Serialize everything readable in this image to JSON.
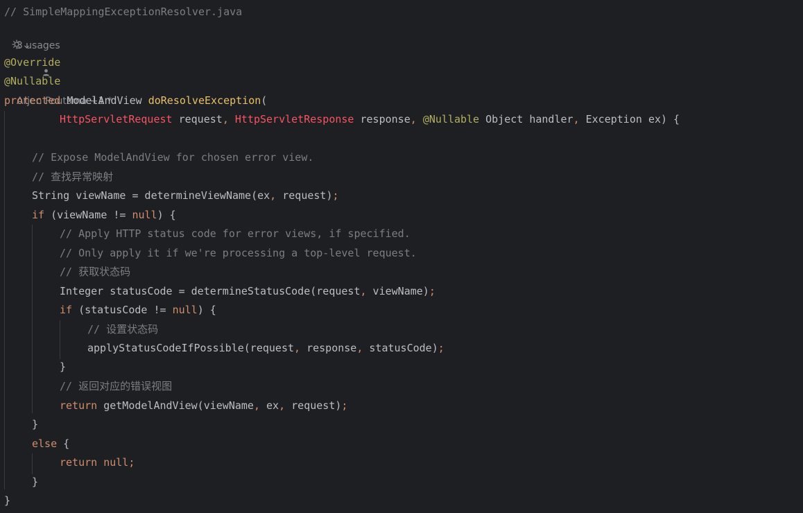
{
  "editor": {
    "file_comment": "// SimpleMappingExceptionResolver.java",
    "inlay": {
      "usages": "3 usages",
      "author": "Arjen Poutsma +1 *"
    },
    "code": {
      "ann_override": "@Override",
      "ann_nullable": "@Nullable",
      "kw_protected": "protected",
      "type_mav": "ModelAndView",
      "method_name": "doResolveException",
      "open_paren": "(",
      "p_req_type": "HttpServletRequest",
      "p_req_name": "request",
      "comma": ",",
      "p_resp_type": "HttpServletResponse",
      "p_resp_name": "response",
      "p_handler_ann": "@Nullable",
      "p_handler_type": "Object",
      "p_handler_name": "handler",
      "p_ex_type": "Exception",
      "p_ex_tail": "ex) {",
      "comment_expose": "// Expose ModelAndView for chosen error view.",
      "comment_find": "// 查找异常映射",
      "l_string": "String viewName = determineViewName(ex",
      "l_string_2": "request)",
      "semi": ";",
      "kw_if": "if",
      "l_if1_a": "(viewName != ",
      "kw_null": "null",
      "l_if1_b": ") {",
      "comment_apply1": "// Apply HTTP status code for error views, if specified.",
      "comment_apply2": "// Only apply it if we're processing a top-level request.",
      "comment_get_status": "// 获取状态码",
      "l_integer": "Integer statusCode = determineStatusCode(request",
      "l_integer_2": "viewName)",
      "l_if2_a": "(statusCode != ",
      "l_if2_b": ") {",
      "comment_set_status": "// 设置状态码",
      "l_apply": "applyStatusCodeIfPossible(request",
      "l_apply_2": "response",
      "l_apply_3": "statusCode)",
      "close_brace": "}",
      "comment_return_view": "// 返回对应的错误视图",
      "kw_return": "return",
      "l_getmav": "getModelAndView(viewName",
      "l_getmav_2": "ex",
      "l_getmav_3": "request)",
      "kw_else": "else",
      "l_else_b": "{",
      "l_return_null": "null"
    }
  },
  "colors": {
    "background": "#1e1f22",
    "comment": "#7a7e85",
    "keyword": "#cf8e6d",
    "annotation": "#b3ae60",
    "method_decl": "#56a8f5",
    "error_type": "#f75464",
    "text": "#bcbec4"
  },
  "icons": {
    "author": "person-icon",
    "ai_gutter": "ai-assistant-icon",
    "dropdown": "chevron-down-icon"
  }
}
